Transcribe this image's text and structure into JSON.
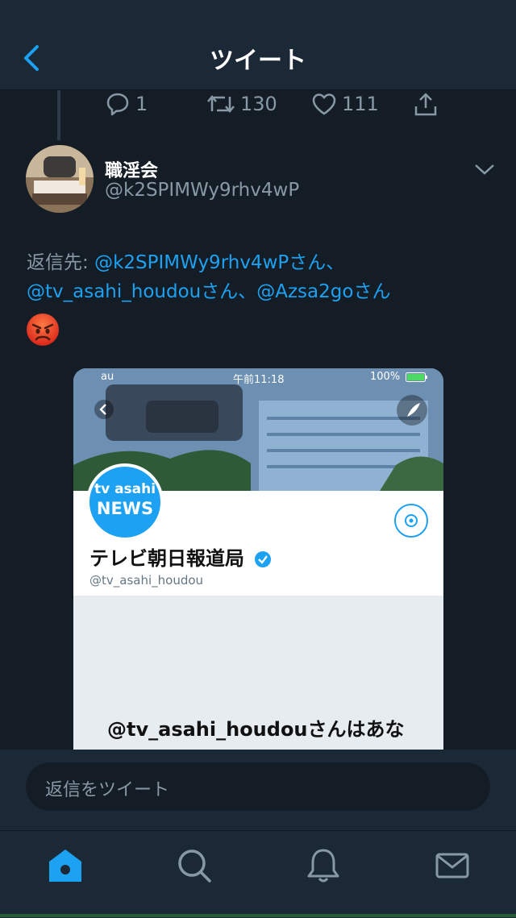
{
  "nav": {
    "title": "ツイート"
  },
  "actions": {
    "replies": "1",
    "retweets": "130",
    "likes": "111"
  },
  "tweet": {
    "display_name": "職淫会",
    "handle": "@k2SPIMWy9rhv4wP",
    "reply_prefix": "返信先: ",
    "mention_1": "@k2SPIMWy9rhv4wPさん、",
    "mention_2": "@tv_asahi_houdouさん、",
    "mention_3": "@Azsa2goさん",
    "emoji": "angry-face"
  },
  "media": {
    "status_carrier": "au",
    "status_time": "午前11:18",
    "status_battery": "100%",
    "logo_line1": "tv asahi",
    "logo_line2": "NEWS",
    "profile_name": "テレビ朝日報道局",
    "profile_handle": "@tv_asahi_houdou",
    "caption": "@tv_asahi_houdouさんはあな"
  },
  "reply_bar": {
    "placeholder": "返信をツイート"
  },
  "tabs": [
    "home",
    "search",
    "notifications",
    "messages"
  ],
  "colors": {
    "background": "#141d26",
    "bar": "#1b2836",
    "accent": "#1da1f2",
    "muted": "#8899a6"
  }
}
